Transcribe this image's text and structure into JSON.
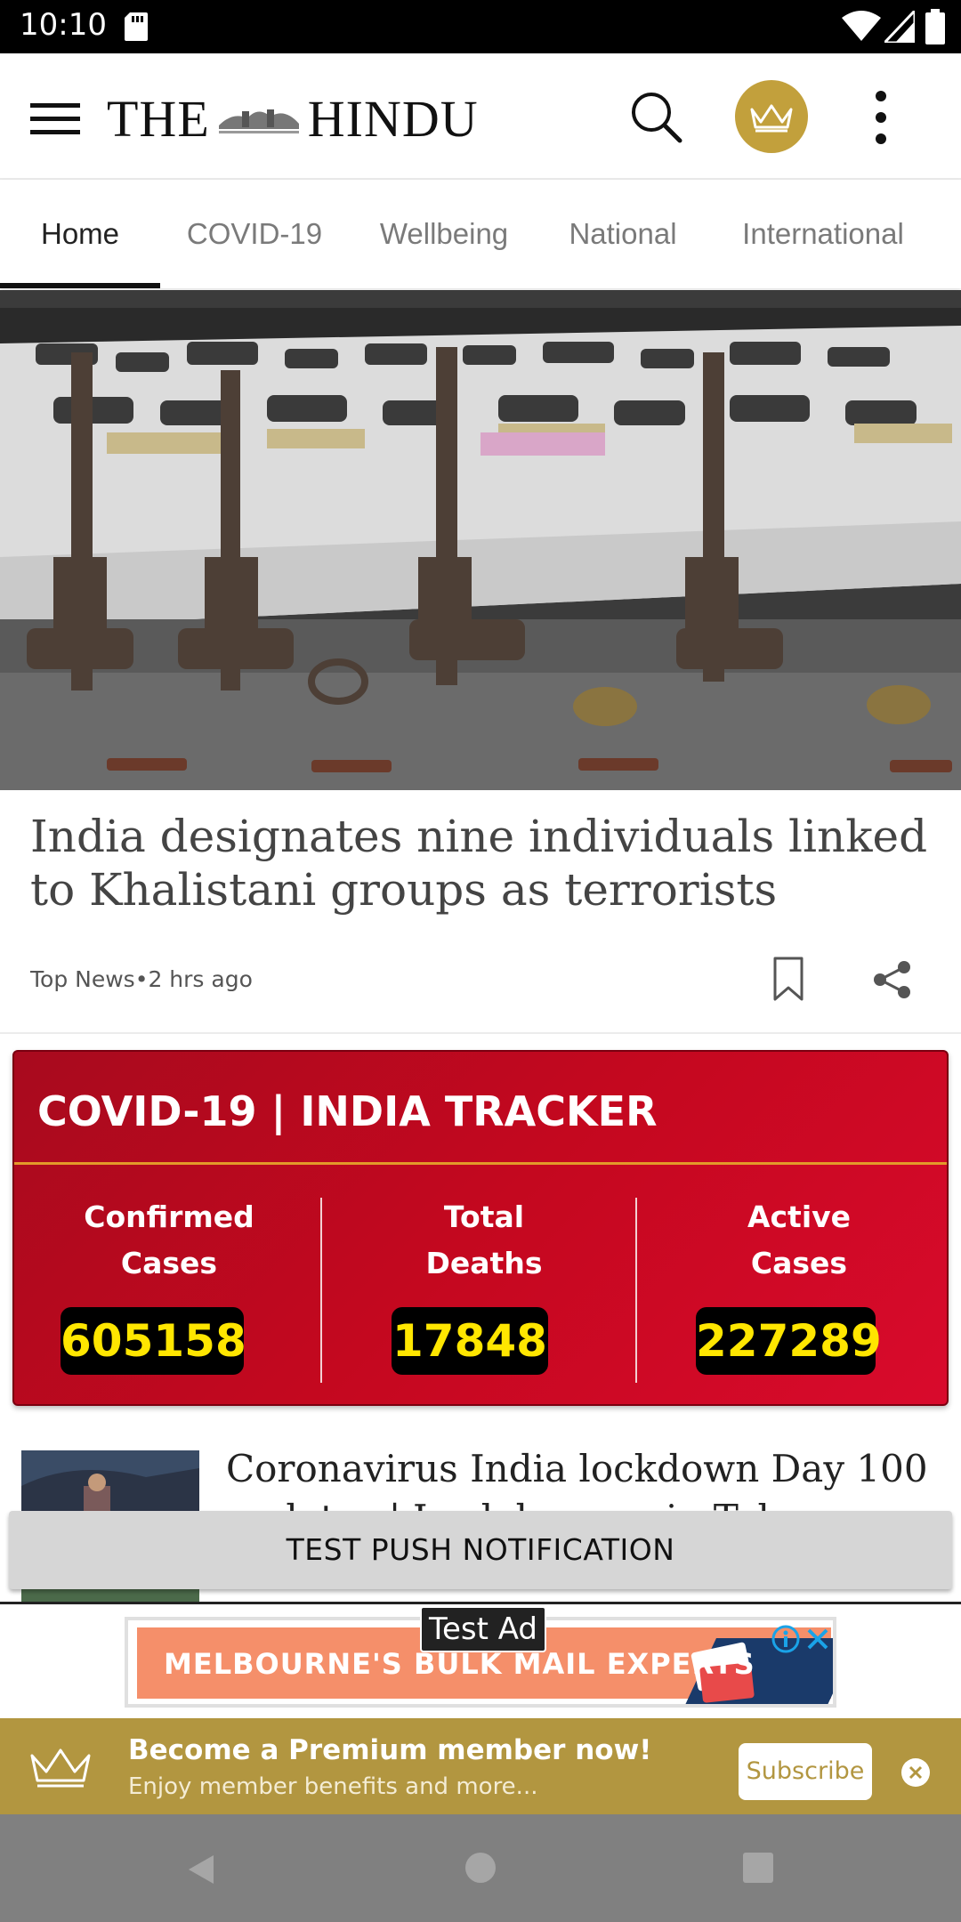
{
  "status_bar": {
    "time": "10:10"
  },
  "app_bar": {
    "logo_text_left": "THE",
    "logo_text_right": "HINDU"
  },
  "tabs": [
    {
      "label": "Home",
      "active": true
    },
    {
      "label": "COVID-19",
      "active": false
    },
    {
      "label": "Wellbeing",
      "active": false
    },
    {
      "label": "National",
      "active": false
    },
    {
      "label": "International",
      "active": false
    }
  ],
  "hero": {
    "title": "India designates nine individuals linked to Khalistani groups as terrorists",
    "category": "Top News",
    "separator": "•",
    "time_ago": "2 hrs ago"
  },
  "tracker": {
    "title": "COVID-19 | INDIA TRACKER",
    "columns": [
      {
        "label_line1": "Confirmed",
        "label_line2": "Cases",
        "value": "605158"
      },
      {
        "label_line1": "Total",
        "label_line2": "Deaths",
        "value": "17848"
      },
      {
        "label_line1": "Active",
        "label_line2": "Cases",
        "value": "227289"
      }
    ]
  },
  "list_item": {
    "title_line1": "Coronavirus India lockdown Day 100 live",
    "title_line2": "updates | Lockdown ... in Tel..."
  },
  "push_button": {
    "label": "TEST PUSH NOTIFICATION"
  },
  "ad": {
    "label": "Test Ad",
    "banner_text": "MELBOURNE'S BULK MAIL EXPERTS"
  },
  "premium": {
    "title": "Become a Premium member now!",
    "subtitle": "Enjoy member benefits and more...",
    "subscribe_label": "Subscribe"
  },
  "colors": {
    "brand_gold": "#b29640",
    "tracker_red": "#c4081f",
    "tracker_value": "#ffe600"
  }
}
